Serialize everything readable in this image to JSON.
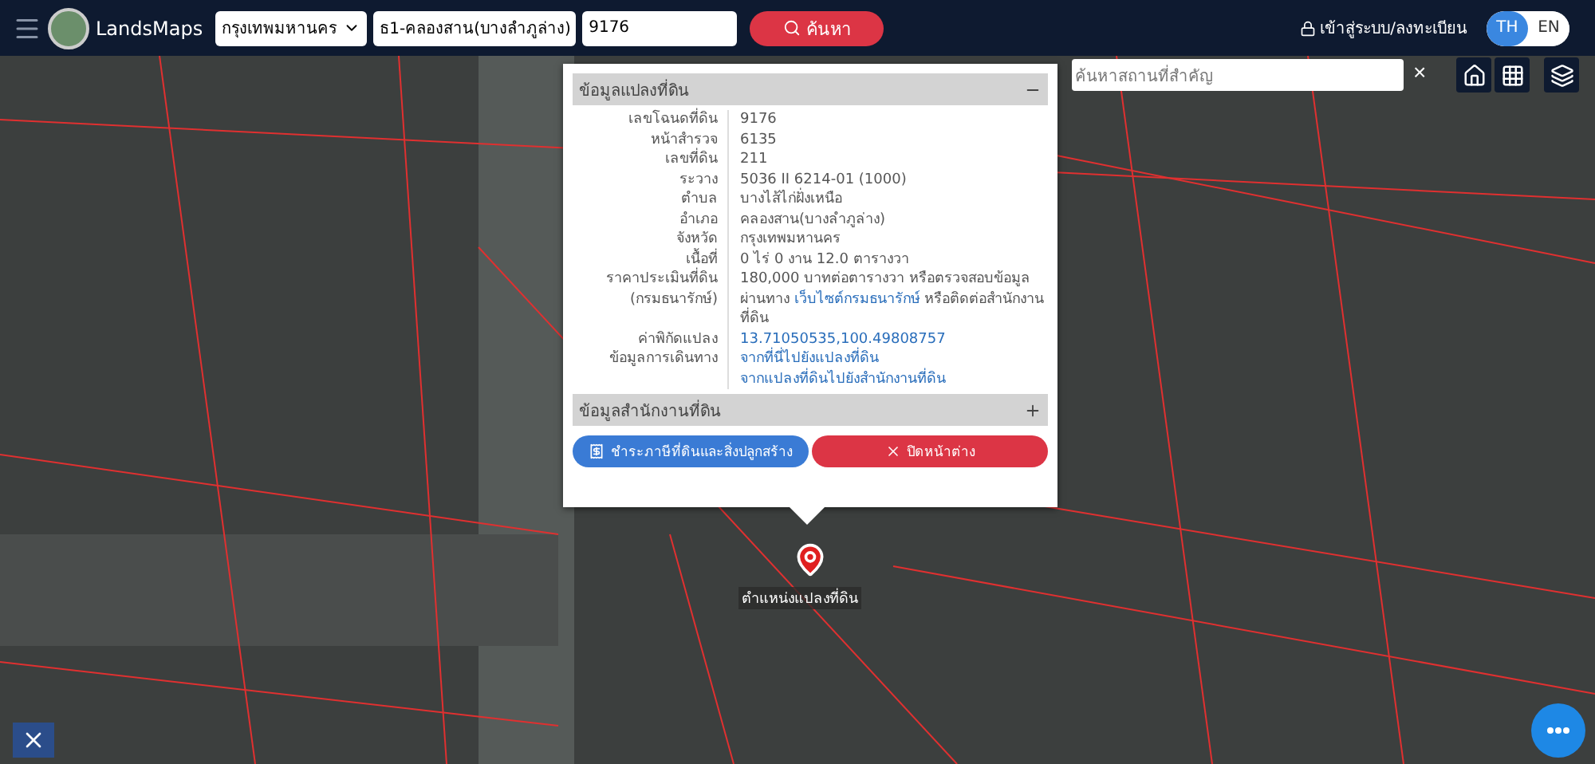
{
  "header": {
    "brand": "LandsMaps",
    "province": "กรุงเทพมหานคร",
    "branch": "ธ1-คลองสาน(บางลำภูล่าง)",
    "parcel_number": "9176",
    "search_button": "ค้นหา",
    "login": "เข้าสู่ระบบ/ลงทะเบียน",
    "languages": [
      {
        "label": "TH",
        "selected": true
      },
      {
        "label": "EN",
        "selected": false
      }
    ]
  },
  "map_search": {
    "placeholder": "ค้นหาสถานที่สำคัญ",
    "clear": "×"
  },
  "popup": {
    "sections": [
      {
        "title": "ข้อมูลแปลงที่ดิน",
        "expanded": true
      },
      {
        "title": "ข้อมูลสำนักงานที่ดิน",
        "expanded": false
      }
    ],
    "rows": [
      {
        "label": "เลขโฉนดที่ดิน",
        "lines": [
          [
            {
              "text": "9176",
              "link": false
            }
          ]
        ]
      },
      {
        "label": "หน้าสำรวจ",
        "lines": [
          [
            {
              "text": "6135",
              "link": false
            }
          ]
        ]
      },
      {
        "label": "เลขที่ดิน",
        "lines": [
          [
            {
              "text": "211",
              "link": false
            }
          ]
        ]
      },
      {
        "label": "ระวาง",
        "lines": [
          [
            {
              "text": "5036 II 6214-01 (1000)",
              "link": false
            }
          ]
        ]
      },
      {
        "label": "ตำบล",
        "lines": [
          [
            {
              "text": "บางไส้ไก่ฝั่งเหนือ",
              "link": false
            }
          ]
        ]
      },
      {
        "label": "อำเภอ",
        "lines": [
          [
            {
              "text": "คลองสาน(บางลำภูล่าง)",
              "link": false
            }
          ]
        ]
      },
      {
        "label": "จังหวัด",
        "lines": [
          [
            {
              "text": "กรุงเทพมหานคร",
              "link": false
            }
          ]
        ]
      },
      {
        "label": "เนื้อที่",
        "lines": [
          [
            {
              "text": "0 ไร่ 0 งาน 12.0 ตารางวา",
              "link": false
            }
          ]
        ]
      },
      {
        "label": "ราคาประเมินที่ดิน (กรมธนารักษ์)",
        "lines": [
          [
            {
              "text": "180,000 บาทต่อตารางวา หรือตรวจสอบข้อมูลผ่านทาง ",
              "link": false
            },
            {
              "text": "เว็บไซต์กรมธนารักษ์",
              "link": true
            },
            {
              "text": " หรือติดต่อสำนักงานที่ดิน",
              "link": false
            }
          ]
        ]
      },
      {
        "label": "ค่าพิกัดแปลง",
        "lines": [
          [
            {
              "text": "13.71050535,100.49808757",
              "link": true
            }
          ]
        ]
      },
      {
        "label": "ข้อมูลการเดินทาง",
        "lines": [
          [
            {
              "text": "จากที่นี่ไปยังแปลงที่ดิน",
              "link": true
            }
          ],
          [
            {
              "text": "จากแปลงที่ดินไปยังสำนักงานที่ดิน",
              "link": true
            }
          ]
        ]
      }
    ],
    "buttons": [
      {
        "label": "ชำระภาษีที่ดินและสิ่งปลูกสร้าง",
        "kind": "primary"
      },
      {
        "label": "ปิดหน้าต่าง",
        "kind": "danger"
      }
    ]
  },
  "marker_label": "ตำแหน่งแปลงที่ดิน"
}
